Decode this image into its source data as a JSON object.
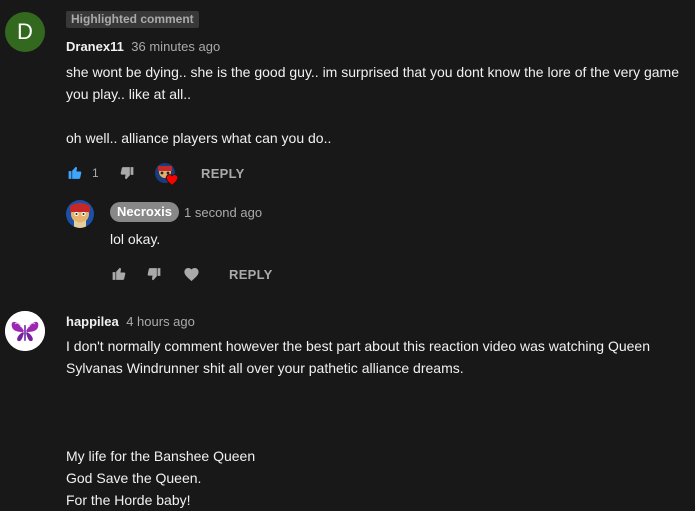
{
  "thread": {
    "badge": "Highlighted comment",
    "avatar_letter": "D",
    "author": "Dranex11",
    "time": "36 minutes ago",
    "text": "she wont be dying.. she is the good guy.. im surprised that you dont know the lore of the very game you play.. like at all..\n\noh well.. alliance players what can you do..",
    "likes": "1",
    "reply_label": "REPLY"
  },
  "reply": {
    "author": "Necroxis",
    "time": "1 second ago",
    "text": "lol okay.",
    "reply_label": "REPLY"
  },
  "comment2": {
    "author": "happilea",
    "time": "4 hours ago",
    "text": "I don't normally comment however the best part about this reaction video was watching Queen Sylvanas Windrunner shit all over your pathetic alliance dreams.\n\n\n\nMy life for the Banshee Queen\nGod Save the Queen.\nFor the Horde baby!"
  },
  "colors": {
    "background": "#181818",
    "like_active": "#3ea6ff",
    "heart": "#ff0000",
    "avatar_d": "#33691e"
  }
}
